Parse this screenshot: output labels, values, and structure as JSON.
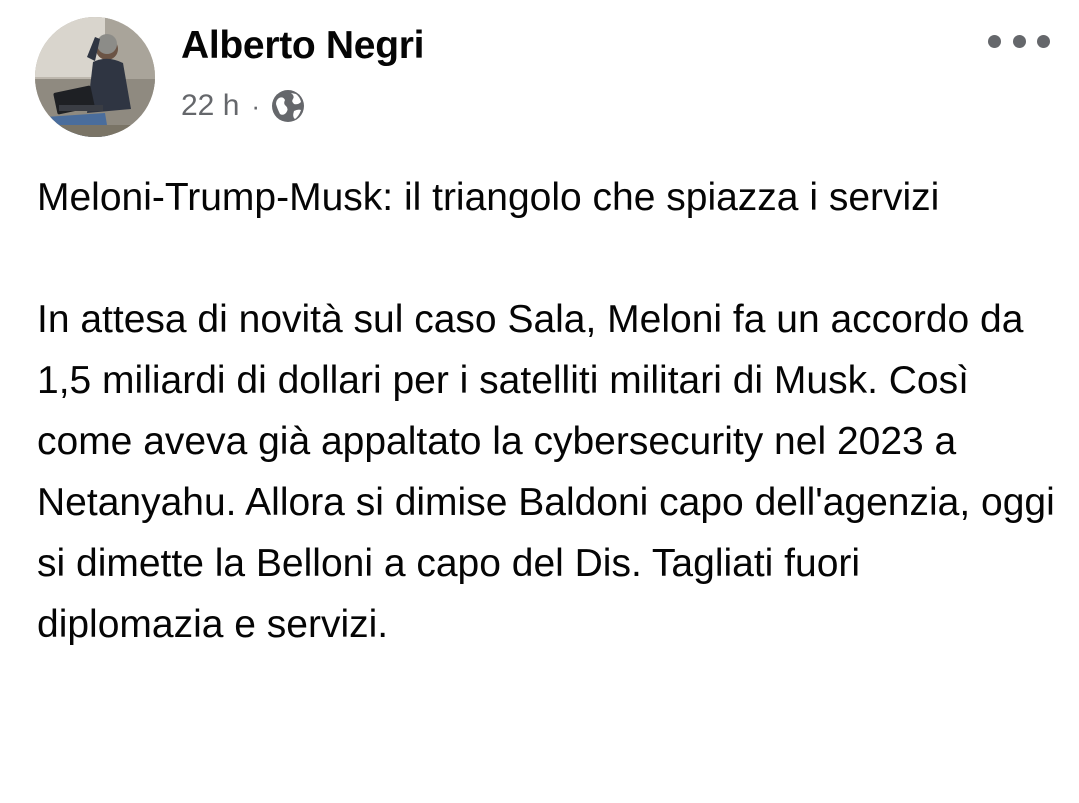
{
  "post": {
    "author": "Alberto Negri",
    "time": "22 h",
    "separator": "·",
    "privacy_icon": "globe-icon",
    "more_icon": "more-options-icon",
    "title_line": "Meloni-Trump-Musk: il triangolo che spiazza i servizi",
    "body": "In attesa di novità sul caso Sala, Meloni fa un accordo da 1,5 miliardi di dollari per i satelliti militari di Musk. Così come aveva già appaltato la cybersecurity nel 2023 a Netanyahu. Allora si dimise Baldoni capo dell'agenzia, oggi si dimette la Belloni a capo del Dis. Tagliati fuori diplomazia e servizi."
  },
  "colors": {
    "text_primary": "#050505",
    "text_secondary": "#65676b",
    "background": "#ffffff"
  }
}
